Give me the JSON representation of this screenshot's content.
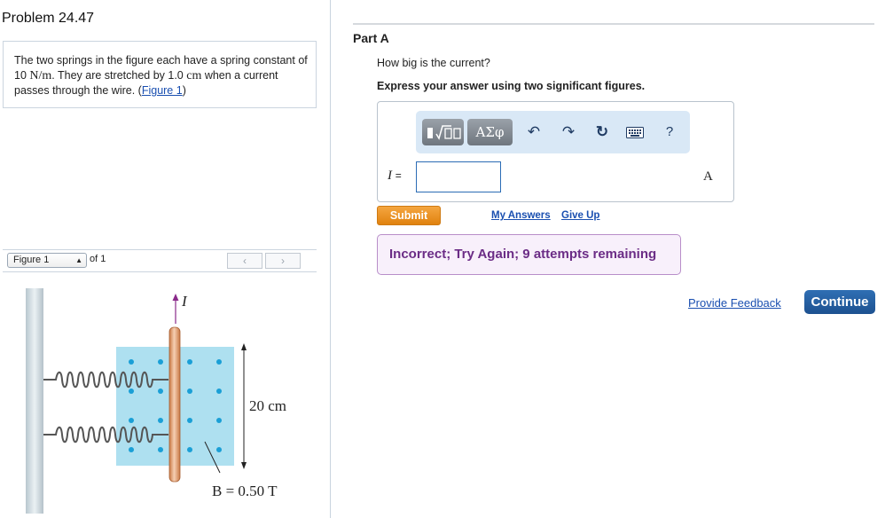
{
  "problem": {
    "title": "Problem 24.47",
    "text_part1": "The two springs in the figure each have a spring constant of 10",
    "k_unit": "N/m",
    "text_part2": ". They are stretched by 1.0",
    "stretch_unit": "cm",
    "text_part3": "when a current passes through the wire. (",
    "figure_link": "Figure 1",
    "text_part4": ")"
  },
  "figure_nav": {
    "selected": "Figure 1",
    "of_text": "of 1",
    "prev_icon": "chevron-left-icon",
    "next_icon": "chevron-right-icon"
  },
  "figure": {
    "current_label": "I",
    "length_label": "20 cm",
    "field_label": "B = 0.50 T"
  },
  "part": {
    "label": "Part A",
    "question": "How big is the current?",
    "instruction": "Express your answer using two significant figures."
  },
  "toolbar": {
    "template_button": "▮√□",
    "greek_button": "ΑΣφ",
    "undo_icon": "↶",
    "redo_icon": "↷",
    "reset_icon": "↻",
    "keyboard_icon": "keyboard-icon",
    "help_label": "?"
  },
  "answer": {
    "variable": "I",
    "equals": "=",
    "value": "",
    "unit": "A"
  },
  "actions": {
    "submit": "Submit",
    "my_answers": "My Answers",
    "give_up": "Give Up"
  },
  "feedback": {
    "message": "Incorrect; Try Again; 9 attempts remaining"
  },
  "footer": {
    "provide_feedback": "Provide Feedback",
    "continue": "Continue"
  },
  "colors": {
    "submit": "#e8901f",
    "continue": "#2563a6",
    "feedback_text": "#6b2c86",
    "link": "#1a4fb0",
    "field_region": "#aee0f0",
    "wire": "#e8a57a"
  }
}
